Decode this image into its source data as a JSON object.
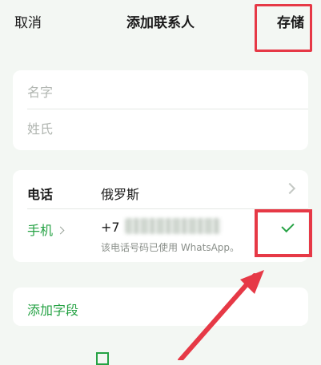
{
  "header": {
    "cancel_label": "取消",
    "title": "添加联系人",
    "save_label": "存储"
  },
  "name_card": {
    "first_name_placeholder": "名字",
    "last_name_placeholder": "姓氏"
  },
  "phone_card": {
    "label": "电话",
    "country": "俄罗斯",
    "mobile_label": "手机",
    "country_code": "+7",
    "whatsapp_note": "该电话号码已使用 WhatsApp。"
  },
  "add_field_label": "添加字段",
  "colors": {
    "accent": "#25a244",
    "annotation": "#e63946",
    "background": "#f3f7f3"
  },
  "icons": [
    "chevron-right-icon",
    "checkmark-icon",
    "qr-code-icon"
  ]
}
